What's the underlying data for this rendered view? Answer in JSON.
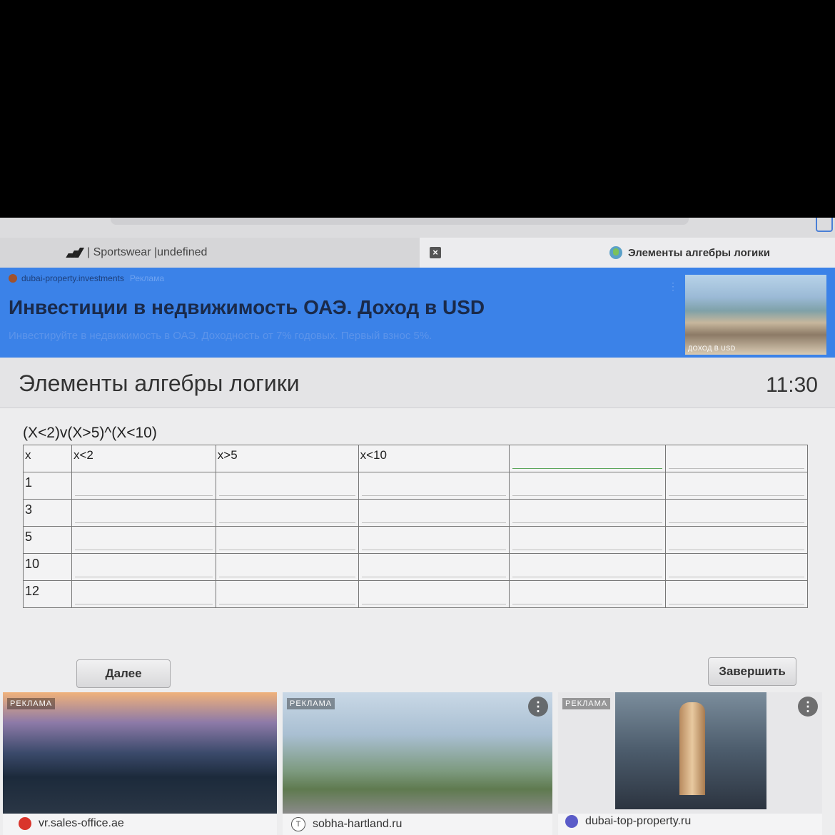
{
  "browser": {
    "tabs": [
      {
        "label": "| Sportswear |undefined",
        "active": false
      },
      {
        "label": "Элементы алгебры логики",
        "active": true
      }
    ],
    "close_glyph": "×"
  },
  "top_ad": {
    "source": "dubai-property.investments",
    "ad_label": "Реклама",
    "title": "Инвестиции в недвижимость ОАЭ. Доход в USD",
    "subtitle": "Инвестируйте в недвижимость в ОАЭ. Доходность от 7% годовых. Первый взнос 5%.",
    "image_caption": "ДОХОД В USD",
    "color": "#3b82e8"
  },
  "quiz": {
    "title": "Элементы алгебры логики",
    "timer": "11:30",
    "formula": "(X<2)v(X>5)^(X<10)",
    "table": {
      "headers": [
        "x",
        "x<2",
        "x>5",
        "x<10",
        "",
        ""
      ],
      "rows": [
        "1",
        "3",
        "5",
        "10",
        "12"
      ]
    },
    "next_label": "Далее",
    "finish_label": "Завершить"
  },
  "bottom_ads": [
    {
      "label": "РЕКЛАМА",
      "domain": "vr.sales-office.ae"
    },
    {
      "label": "РЕКЛАМА",
      "domain": "sobha-hartland.ru"
    },
    {
      "label": "РЕКЛАМА",
      "domain": "dubai-top-property.ru"
    }
  ]
}
